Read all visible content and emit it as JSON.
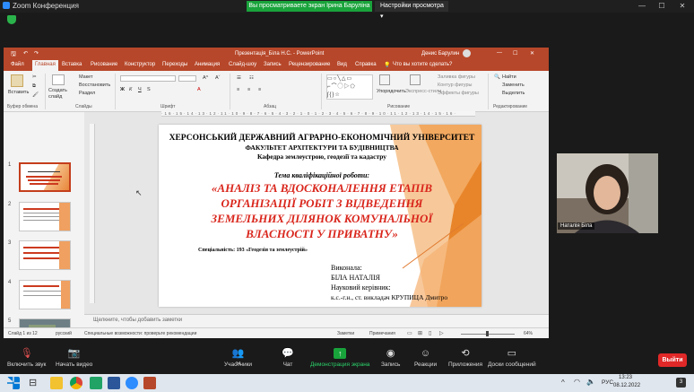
{
  "zoom": {
    "window_title": "Zoom Конференция",
    "share_banner": "Вы просматриваете экран Ірина Баруліна",
    "view_options": "Настройки просмотра",
    "participant_name": "Наталія Біла",
    "controls": {
      "audio": "Включить звук",
      "video": "Начать видео",
      "participants": "Участники",
      "participants_count": "14",
      "chat": "Чат",
      "share": "Демонстрация экрана",
      "record": "Запись",
      "reactions": "Реакции",
      "apps": "Приложения",
      "breakout": "Доски сообщений",
      "leave": "Выйти"
    },
    "colors": {
      "share_green": "#19a33b",
      "leave_red": "#e02828",
      "ppt_red": "#b7472a"
    }
  },
  "powerpoint": {
    "title": "Презентація_Біла Н.С. - PowerPoint",
    "user": "Денис Барулин",
    "tabs": [
      "Файл",
      "Главная",
      "Вставка",
      "Рисование",
      "Конструктор",
      "Переходы",
      "Анимация",
      "Слайд-шоу",
      "Запись",
      "Рецензирование",
      "Вид",
      "Справка"
    ],
    "tell_me": "Что вы хотите сделать?",
    "ribbon": {
      "paste": "Вставить",
      "create_slide": "Создать слайд",
      "layout": "Макет",
      "reset": "Восстановить",
      "section": "Раздел",
      "arrange": "Упорядочить",
      "quick_styles": "Экспресс-стили",
      "fill": "Заливка фигуры",
      "outline": "Контур фигуры",
      "effects": "Эффекты фигуры",
      "find": "Найти",
      "replace": "Заменить",
      "select": "Выделить",
      "groups": [
        "Буфер обмена",
        "Слайды",
        "Шрифт",
        "Абзац",
        "Рисование",
        "Редактирование"
      ]
    },
    "slide": {
      "university": "ХЕРСОНСЬКИЙ ДЕРЖАВНИЙ АГРАРНО-ЕКОНОМІЧНИЙ УНІВЕРСИТЕТ",
      "faculty": "ФАКУЛЬТЕТ АРХІТЕКТУРИ ТА БУДІВНИЦТВА",
      "department": "Кафедра землеустрою, геодезії та кадастру",
      "theme_label": "Тема кваліфікаційної роботи:",
      "title_line1": "«АНАЛІЗ ТА ВДОСКОНАЛЕННЯ ЕТАПІВ",
      "title_line2": "ОРГАНІЗАЦІЇ РОБІТ З ВІДВЕДЕННЯ",
      "title_line3": "ЗЕМЕЛЬНИХ ДІЛЯНОК КОМУНАЛЬНОЇ",
      "title_line4": "ВЛАСНОСТІ У ПРИВАТНУ»",
      "specialty": "Спеціальність: 193 «Геодезія та землеустрій»",
      "performed": "Виконала:",
      "student": "БІЛА НАТАЛІЯ",
      "supervisor_label": "Науковий керівник:",
      "supervisor": "к.с.-г.н., ст. викладач КРУПИЦА Дмитро"
    },
    "thumb_numbers": [
      "1",
      "2",
      "3",
      "4",
      "5",
      "6"
    ],
    "notes_placeholder": "Щелкните, чтобы добавить заметки",
    "status": {
      "slide": "Слайд 1 из 12",
      "language": "русский",
      "accessibility": "Специальные возможности: проверьте рекомендации",
      "notes": "Заметки",
      "comments": "Примечания",
      "zoom": "64%"
    }
  },
  "taskbar": {
    "lang": "РУС",
    "time": "13:23",
    "date": "08.12.2022",
    "notifications": "3"
  }
}
